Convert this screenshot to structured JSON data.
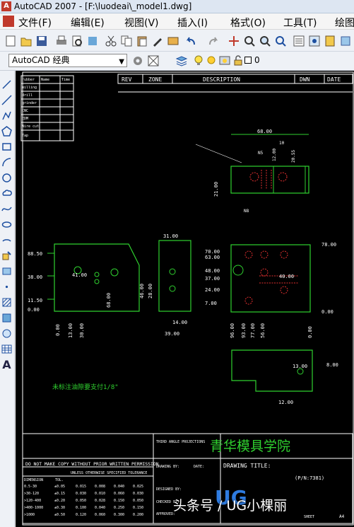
{
  "window": {
    "title": "AutoCAD 2007 - [F:\\luodeai\\_model1.dwg]"
  },
  "menu": [
    "文件(F)",
    "编辑(E)",
    "视图(V)",
    "插入(I)",
    "格式(O)",
    "工具(T)",
    "绘图"
  ],
  "workspace": {
    "name": "AutoCAD 经典"
  },
  "layer": {
    "name": "0"
  },
  "drawing": {
    "rev_header": [
      "REV",
      "ZONE",
      "DESCRIPTION",
      "DWN",
      "DATE"
    ],
    "table_rows": [
      "rubber",
      "milling",
      "drill",
      "grinder",
      "CNC",
      "EDM",
      "Wire cut",
      "Tap"
    ],
    "table_headers": [
      "Name",
      "Time"
    ],
    "top_dims": [
      "68.00",
      "10",
      "12.00",
      "20.55",
      "21.00",
      "N5",
      "N8"
    ],
    "left_dims": [
      "88.50",
      "38.00",
      "11.50",
      "0.00",
      "13.00",
      "30.00",
      "41.00",
      "68.00"
    ],
    "mid_dims": [
      "31.00",
      "46.00",
      "28.00",
      "14.00",
      "39.00"
    ],
    "right_dims": [
      "78.00",
      "70.00",
      "63.00",
      "48.00",
      "37.00",
      "24.00",
      "7.00",
      "0.00",
      "40.00",
      "96.00",
      "93.00",
      "77.00",
      "56.00",
      "0.00",
      "8.00",
      "12.00",
      "13.00"
    ],
    "note": "未标注油隙要支付1/8\"",
    "company": "青华模具学院",
    "drawing_title_label": "DRAWING TITLE:",
    "pn": "(P/N:7381)",
    "warning": "DO NOT MAKE COPY WITHOUT PRIOR WRITTEN PERMISSION",
    "tolerance_header": "UNLESS OTHERWISE SPECIFIED TOLERANCE",
    "dimension_label": "DIMENSION",
    "tol_label": "TOL.",
    "tol_rows": [
      [
        "0.5-30",
        "±0.05",
        "0.015",
        "0.008",
        "0.040",
        "0.025"
      ],
      [
        ">30-120",
        "±0.15",
        "0.030",
        "0.010",
        "0.060",
        "0.030"
      ],
      [
        ">120-400",
        "±0.20",
        "0.050",
        "0.028",
        "0.150",
        "0.050"
      ],
      [
        ">400-1000",
        "±0.30",
        "0.100",
        "0.040",
        "0.250",
        "0.150"
      ],
      [
        ">1000",
        "±0.50",
        "0.120",
        "0.060",
        "0.300",
        "0.200"
      ]
    ],
    "third_angle": "THIRD ANGLE PROJECTIONS",
    "drawn_by": "DRAWING BY:",
    "designed_by": "DESIGNED BY:",
    "checked_by": "CHECKED BY:",
    "approved": "APPROVED:",
    "dates": "DATE:",
    "sheet": "SHEET",
    "size": "A4"
  },
  "watermark": "头条号 / UG小棵丽"
}
